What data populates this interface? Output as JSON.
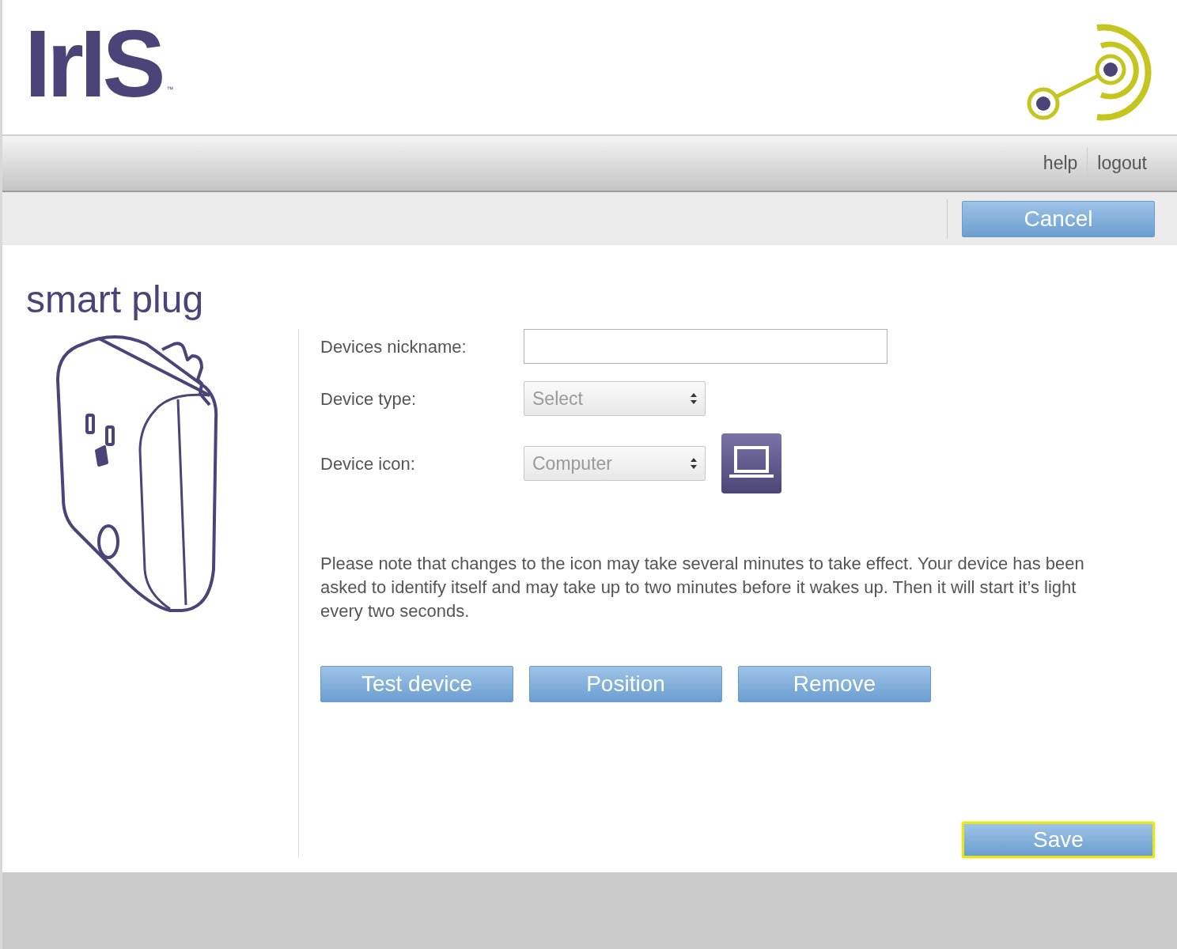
{
  "header": {
    "logo": "IrIS",
    "trademark": "™"
  },
  "nav": {
    "links": [
      "help",
      "logout"
    ]
  },
  "toolbar": {
    "cancel": "Cancel"
  },
  "device": {
    "title": "smart plug"
  },
  "form": {
    "fields": [
      {
        "kind": "text",
        "label": "Devices nickname:"
      },
      {
        "kind": "select",
        "label": "Device type:",
        "value": "Select"
      },
      {
        "kind": "icon-select",
        "label": "Device icon:",
        "value": "Computer"
      }
    ],
    "note": "Please note that changes to the icon may take several minutes to take effect. Your device has been asked to identify itself and may take up to two minutes before it wakes up. Then it will start it’s light every two seconds.",
    "actions": [
      "Test device",
      "Position",
      "Remove"
    ],
    "save": {
      "label": "Save",
      "focused": true
    }
  }
}
